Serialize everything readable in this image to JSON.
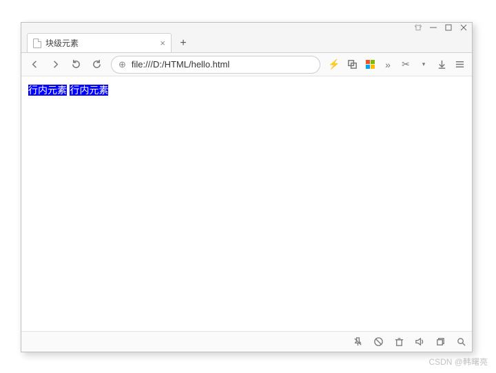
{
  "tab": {
    "title": "块级元素"
  },
  "address": {
    "url": "file:///D:/HTML/hello.html"
  },
  "content": {
    "inline1": "行内元素",
    "inline2": "行内元素"
  },
  "watermark": "CSDN @韩曙亮"
}
